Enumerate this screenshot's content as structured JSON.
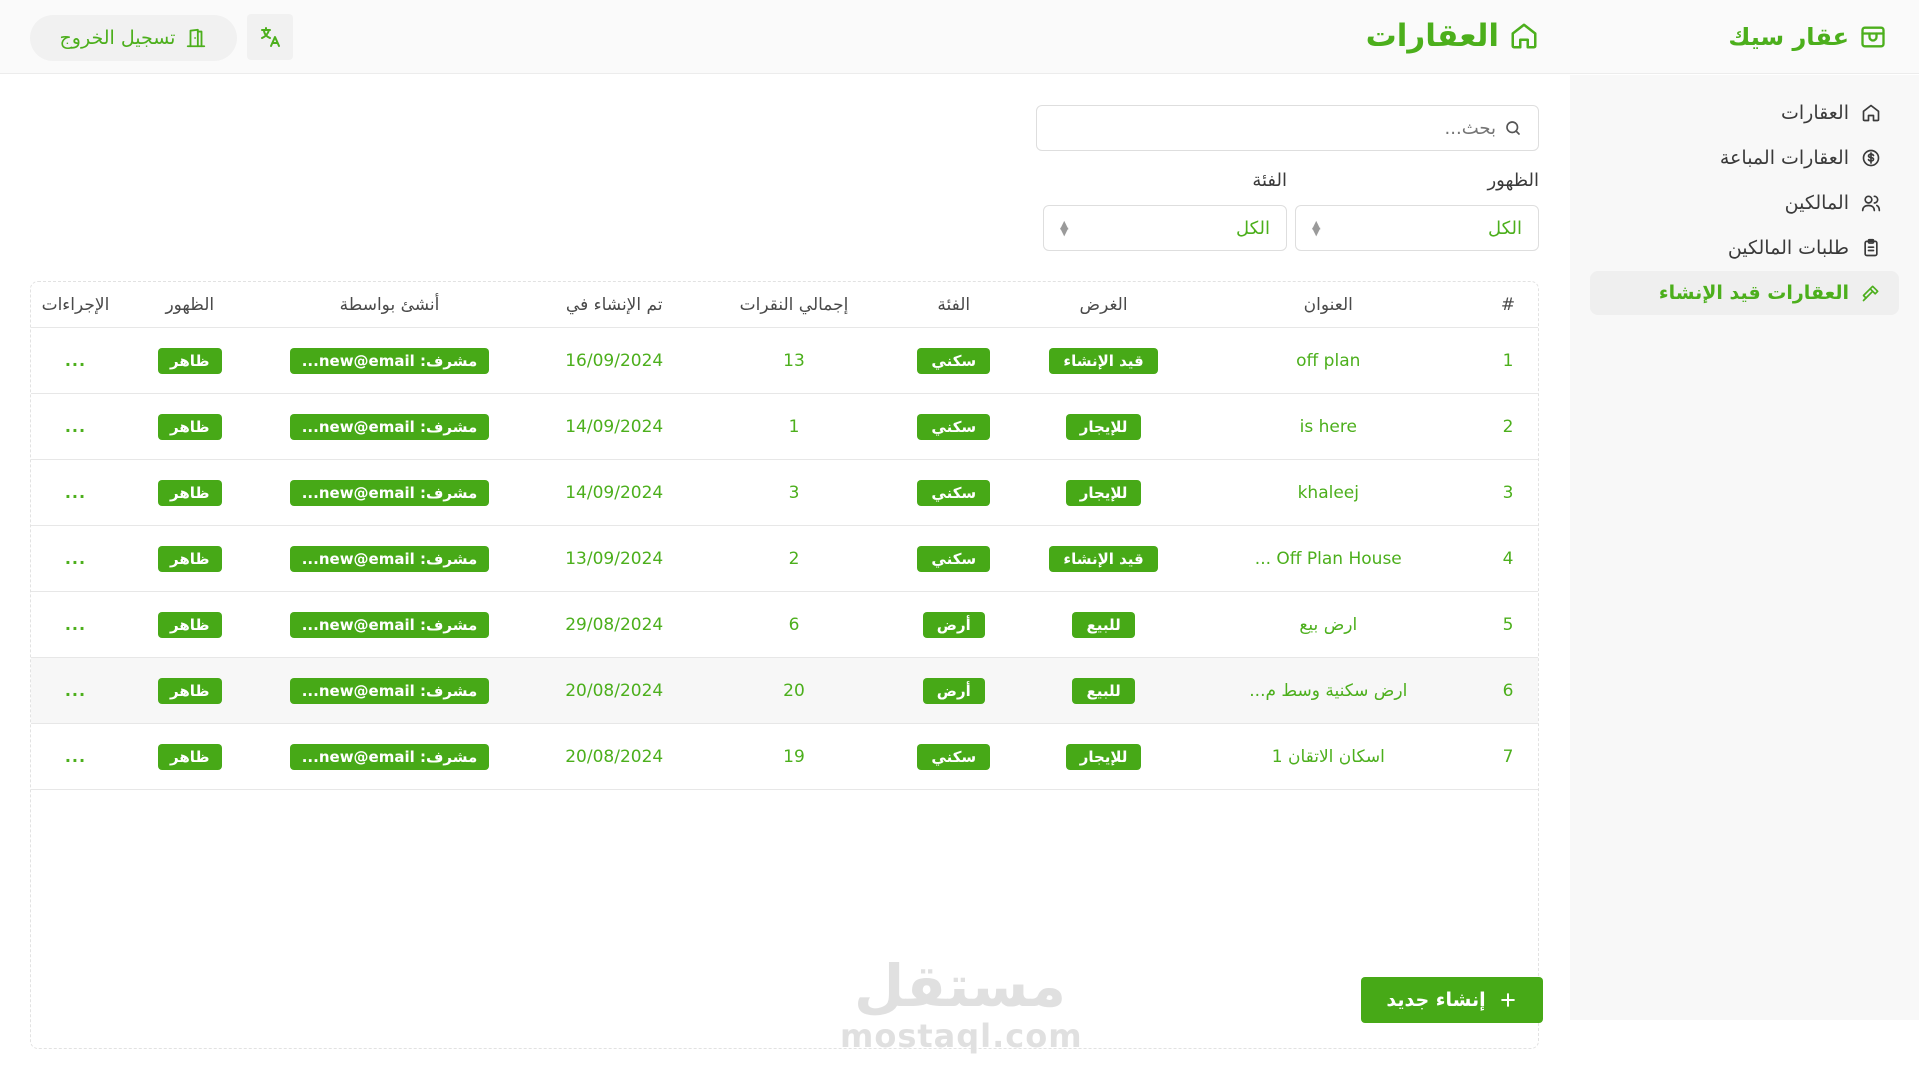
{
  "app": {
    "brand": "عقار سيك",
    "page_title": "العقارات",
    "logout_label": "تسجيل الخروج"
  },
  "sidebar": {
    "items": [
      {
        "label": "العقارات",
        "icon": "home-icon",
        "active": false
      },
      {
        "label": "العقارات المباعة",
        "icon": "dollar-circle-icon",
        "active": false
      },
      {
        "label": "المالكين",
        "icon": "users-icon",
        "active": false
      },
      {
        "label": "طلبات المالكين",
        "icon": "clipboard-icon",
        "active": false
      },
      {
        "label": "العقارات قيد الإنشاء",
        "icon": "hammer-icon",
        "active": true
      }
    ]
  },
  "filters": {
    "search_placeholder": "بحث...",
    "visibility_label": "الظهور",
    "visibility_value": "الكل",
    "category_label": "الفئة",
    "category_value": "الكل"
  },
  "table": {
    "headers": {
      "num": "#",
      "title": "العنوان",
      "purpose": "الغرض",
      "category": "الفئة",
      "clicks": "إجمالي النقرات",
      "created_at": "تم الإنشاء في",
      "created_by": "أنشئ بواسطة",
      "visibility": "الظهور",
      "actions": "الإجراءات"
    },
    "rows": [
      {
        "num": "1",
        "title": "off plan",
        "purpose": "قيد الإنشاء",
        "category": "سكني",
        "clicks": "13",
        "created_at": "16/09/2024",
        "created_by": "مشرف: new@email...",
        "visibility": "ظاهر",
        "actions": "..."
      },
      {
        "num": "2",
        "title": "is here",
        "purpose": "للإيجار",
        "category": "سكني",
        "clicks": "1",
        "created_at": "14/09/2024",
        "created_by": "مشرف: new@email...",
        "visibility": "ظاهر",
        "actions": "..."
      },
      {
        "num": "3",
        "title": "khaleej",
        "purpose": "للإيجار",
        "category": "سكني",
        "clicks": "3",
        "created_at": "14/09/2024",
        "created_by": "مشرف: new@email...",
        "visibility": "ظاهر",
        "actions": "..."
      },
      {
        "num": "4",
        "title": "Off Plan House ...",
        "purpose": "قيد الإنشاء",
        "category": "سكني",
        "clicks": "2",
        "created_at": "13/09/2024",
        "created_by": "مشرف: new@email...",
        "visibility": "ظاهر",
        "actions": "..."
      },
      {
        "num": "5",
        "title": "ارض بيع",
        "purpose": "للبيع",
        "category": "أرض",
        "clicks": "6",
        "created_at": "29/08/2024",
        "created_by": "مشرف: new@email...",
        "visibility": "ظاهر",
        "actions": "..."
      },
      {
        "num": "6",
        "title": "ارض سكنية وسط م...",
        "purpose": "للبيع",
        "category": "أرض",
        "clicks": "20",
        "created_at": "20/08/2024",
        "created_by": "مشرف: new@email...",
        "visibility": "ظاهر",
        "actions": "..."
      },
      {
        "num": "7",
        "title": "اسكان الاتقان 1",
        "purpose": "للإيجار",
        "category": "سكني",
        "clicks": "19",
        "created_at": "20/08/2024",
        "created_by": "مشرف: new@email...",
        "visibility": "ظاهر",
        "actions": "..."
      }
    ]
  },
  "actions": {
    "create_label": "إنشاء جديد"
  },
  "watermark": {
    "arabic": "مستقل",
    "latin": "mostaql.com"
  },
  "colors": {
    "accent": "#4caf1c",
    "badge": "#47a917"
  }
}
